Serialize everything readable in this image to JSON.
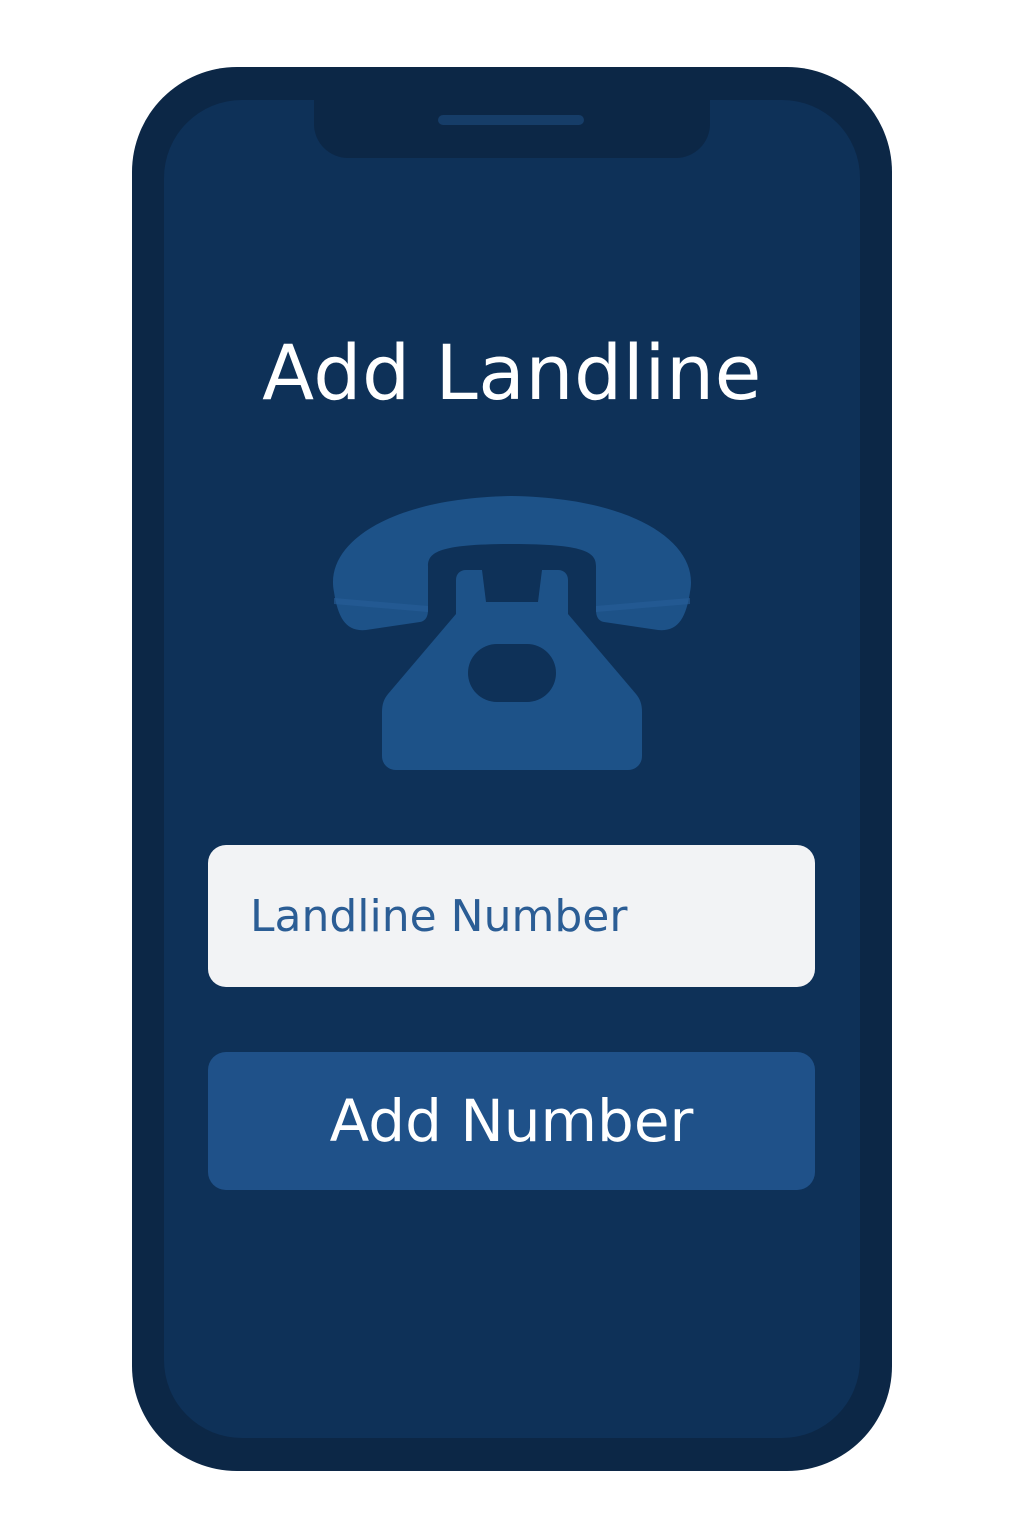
{
  "screen": {
    "title": "Add Landline",
    "illustration": "telephone-icon"
  },
  "form": {
    "number_placeholder": "Landline Number",
    "number_value": "",
    "submit_label": "Add Number"
  },
  "colors": {
    "frame": "#0c2746",
    "screen_background": "#0e3158",
    "accent": "#1f5189",
    "icon": "#1d5288",
    "input_background": "#f2f3f5",
    "input_text": "#2b5d95",
    "title_text": "#ffffff"
  }
}
